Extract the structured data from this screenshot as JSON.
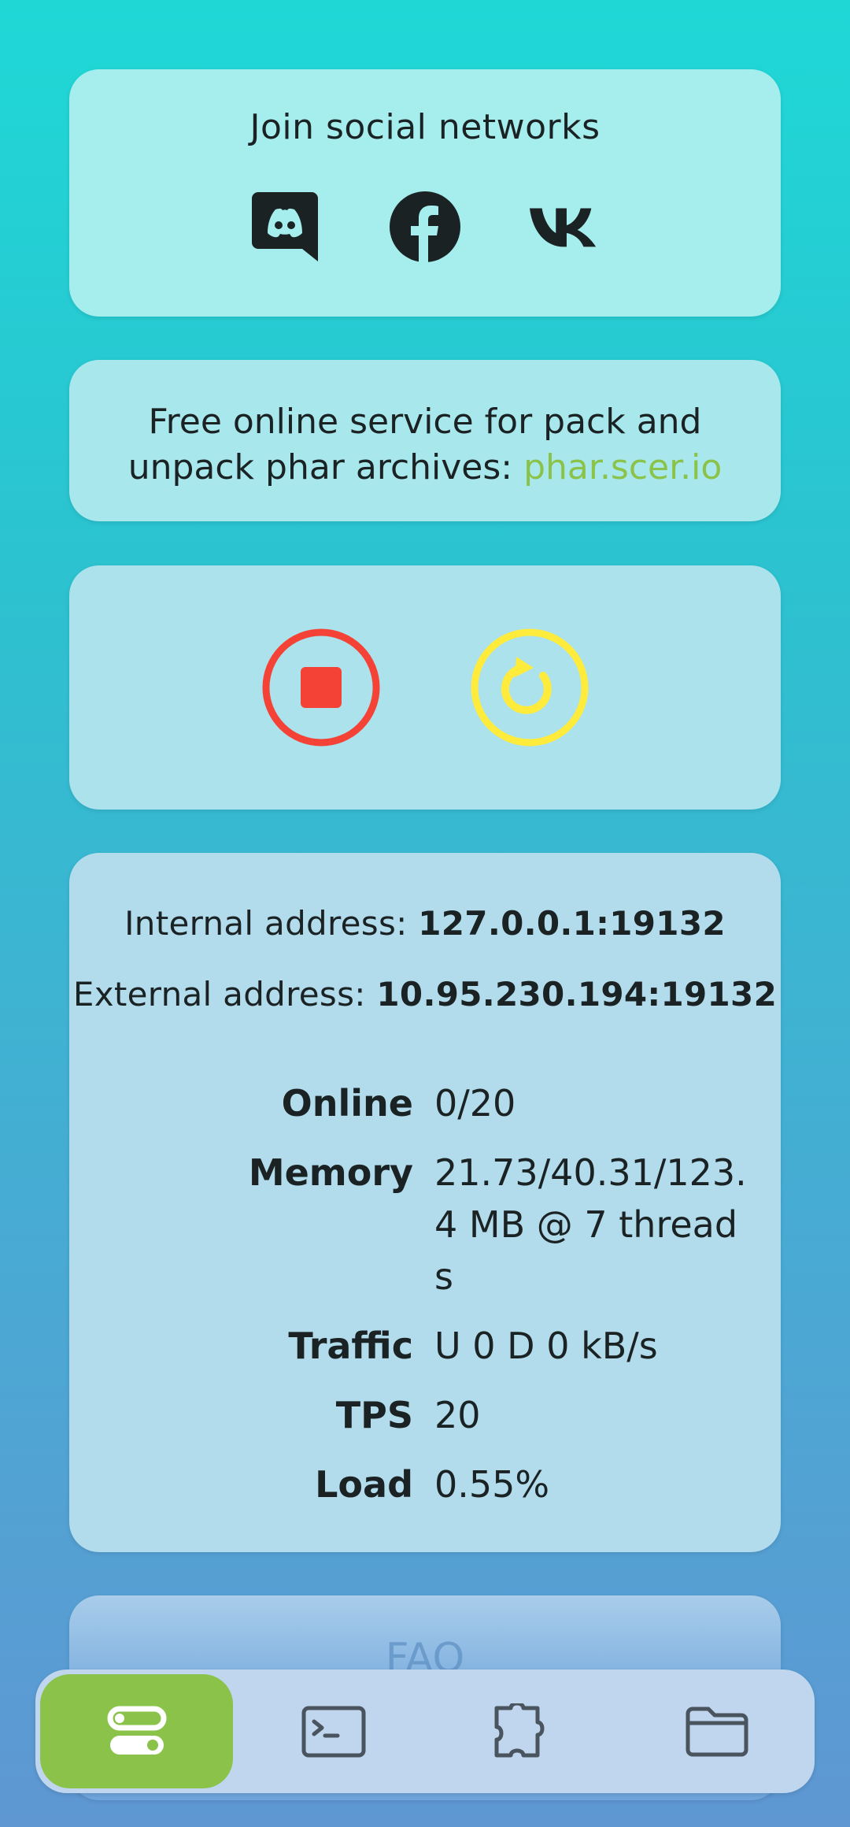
{
  "social": {
    "title": "Join social networks",
    "icons": [
      "discord-icon",
      "facebook-icon",
      "vk-icon"
    ]
  },
  "phar": {
    "text_line1": "Free online service for pack and",
    "text_line2": "unpack phar archives: ",
    "link": "phar.scer.io",
    "link_color": "#8bc34a"
  },
  "controls": {
    "stop_icon": "stop-icon",
    "restart_icon": "restart-icon",
    "stop_color": "#f44336",
    "restart_color": "#ffeb3b"
  },
  "status": {
    "internal_label": "Internal address: ",
    "internal_value": "127.0.0.1:19132",
    "external_label": "External address: ",
    "external_value": "10.95.230.194:19132",
    "rows": [
      {
        "label": "Online",
        "value": "0/20"
      },
      {
        "label": "Memory",
        "value": "21.73/40.31/123.4 MB @ 7 threads"
      },
      {
        "label": "Traffic",
        "value": "U 0 D 0 kB/s"
      },
      {
        "label": "TPS",
        "value": "20"
      },
      {
        "label": "Load",
        "value": "0.55%"
      }
    ]
  },
  "faq": {
    "title": "FAQ"
  },
  "nav": {
    "items": [
      "toggles-icon",
      "terminal-icon",
      "puzzle-icon",
      "folder-icon"
    ],
    "active_index": 0,
    "active_color": "#8bc34a"
  }
}
